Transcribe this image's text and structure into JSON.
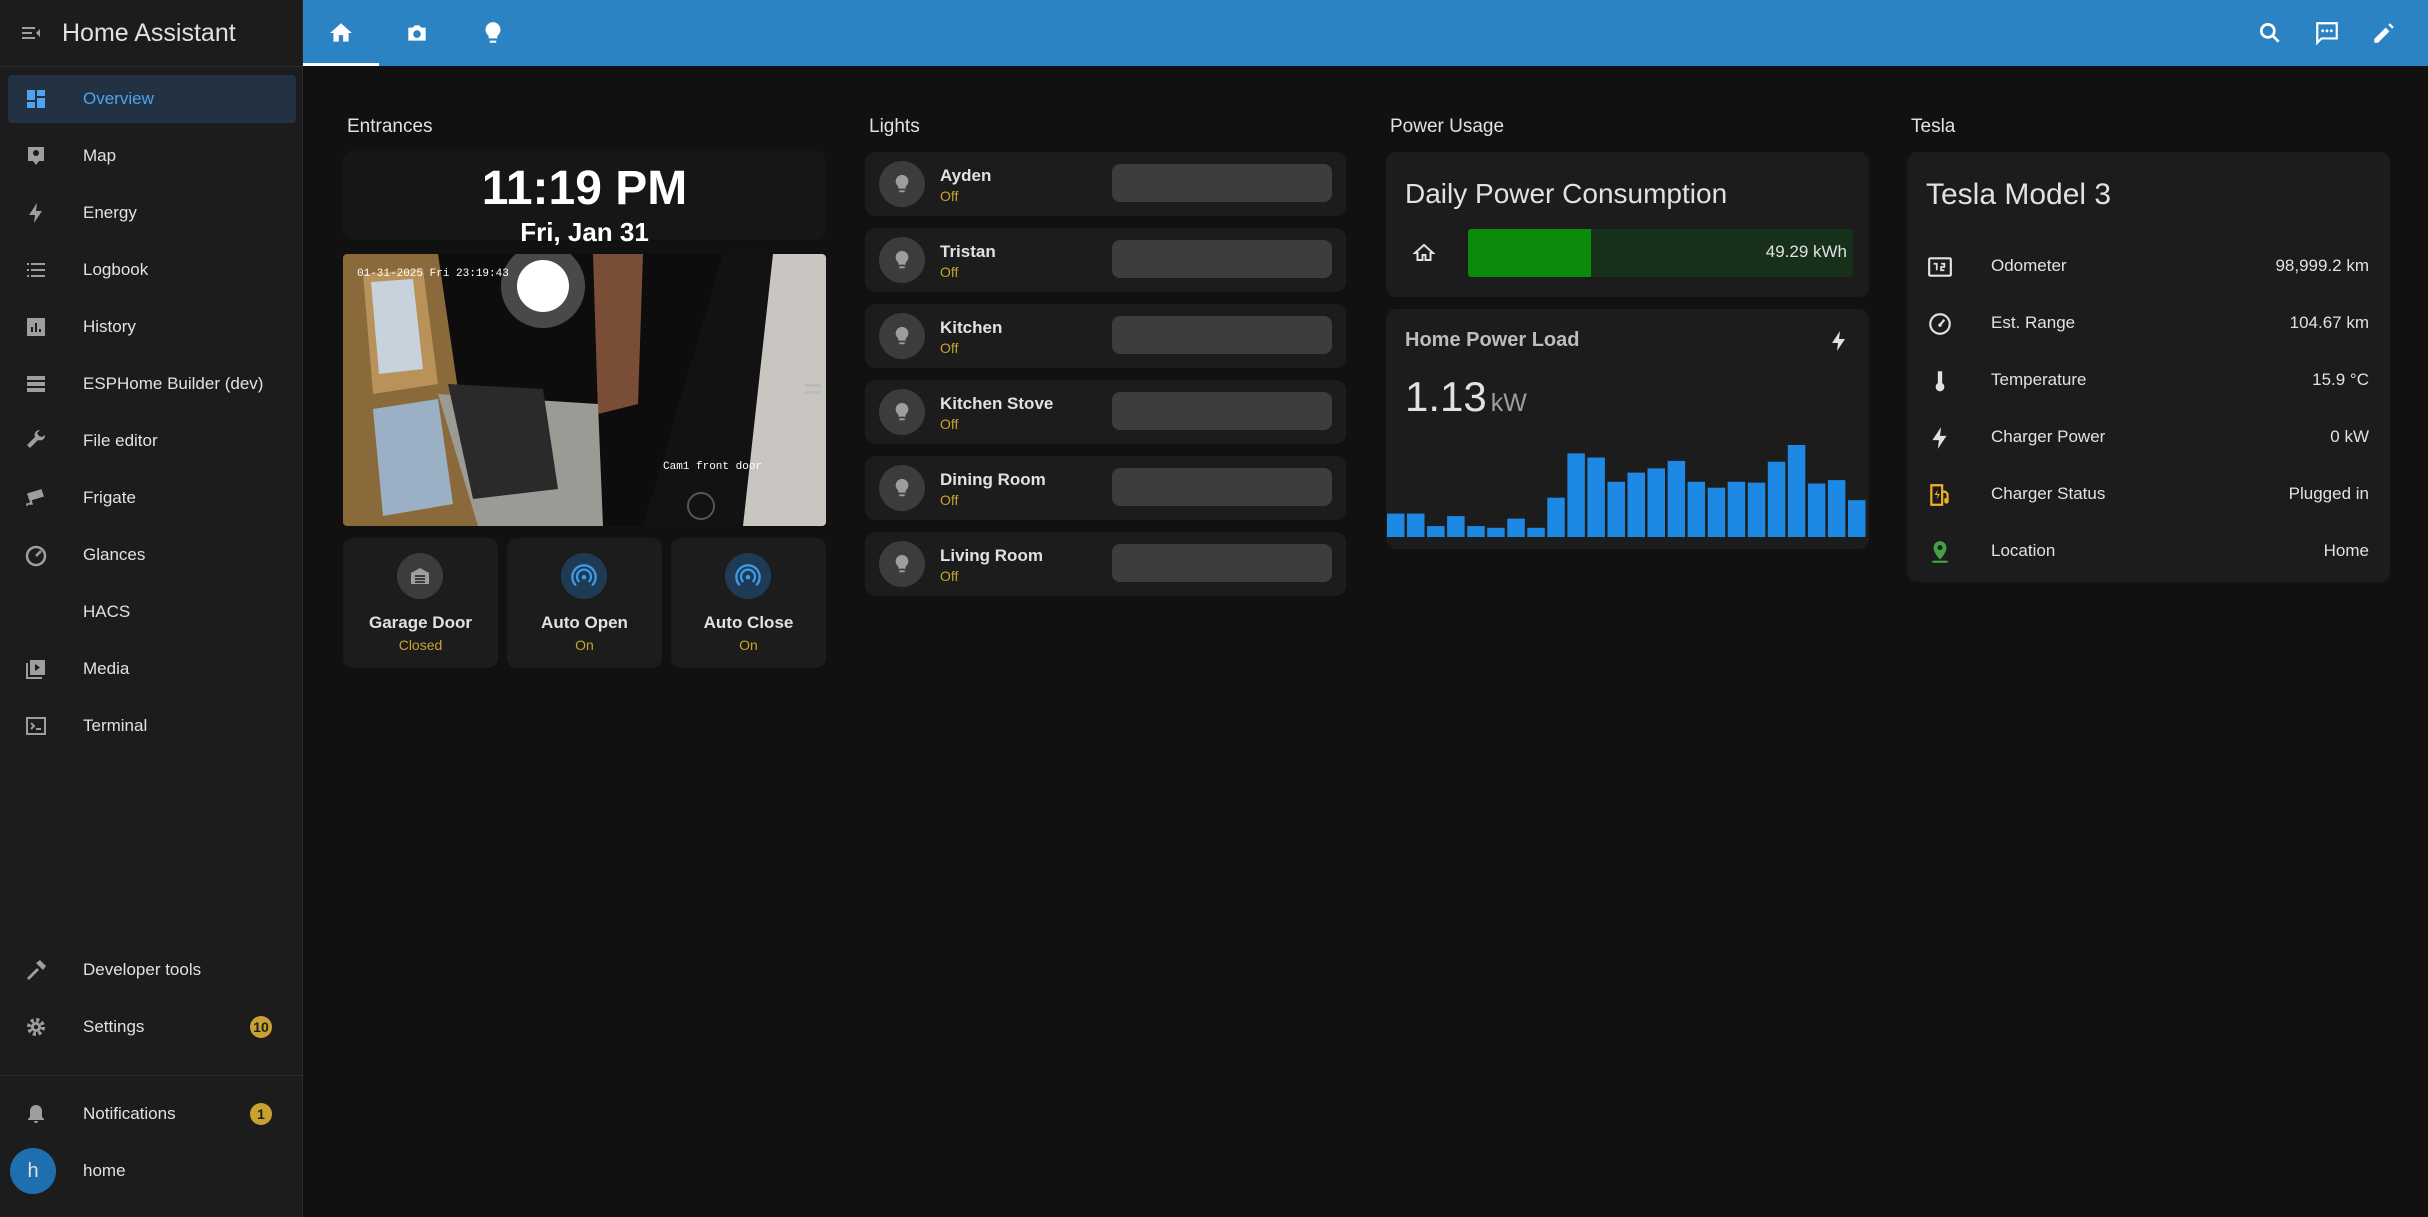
{
  "app": {
    "title": "Home Assistant"
  },
  "sidebar": {
    "items": [
      {
        "label": "Overview",
        "icon": "dashboard-icon",
        "active": true
      },
      {
        "label": "Map",
        "icon": "map-icon"
      },
      {
        "label": "Energy",
        "icon": "lightning-icon"
      },
      {
        "label": "Logbook",
        "icon": "list-icon"
      },
      {
        "label": "History",
        "icon": "bar-chart-icon"
      },
      {
        "label": "ESPHome Builder (dev)",
        "icon": "chip-icon"
      },
      {
        "label": "File editor",
        "icon": "wrench-icon"
      },
      {
        "label": "Frigate",
        "icon": "cctv-icon"
      },
      {
        "label": "Glances",
        "icon": "gauge-icon"
      },
      {
        "label": "HACS",
        "icon": ""
      },
      {
        "label": "Media",
        "icon": "media-icon"
      },
      {
        "label": "Terminal",
        "icon": "console-icon"
      }
    ],
    "developer_tools": "Developer tools",
    "settings": {
      "label": "Settings",
      "badge": "10"
    },
    "notifications": {
      "label": "Notifications",
      "badge": "1"
    },
    "user": {
      "initial": "h",
      "name": "home"
    }
  },
  "header": {
    "tabs": [
      "home-icon",
      "camera-icon",
      "lightbulb-icon"
    ],
    "actions": [
      "search-icon",
      "assist-icon",
      "pencil-icon"
    ],
    "color": "#2b83c3"
  },
  "entrances": {
    "title": "Entrances",
    "clock": {
      "time": "11:19 PM",
      "date": "Fri, Jan 31"
    },
    "camera": {
      "overlay_timestamp": "01-31-2025 Fri 23:19:43",
      "overlay_label": "Cam1 front door"
    },
    "tiles": [
      {
        "name": "Garage Door",
        "state": "Closed",
        "icon": "garage-icon"
      },
      {
        "name": "Auto Open",
        "state": "On",
        "icon": "wireless-icon"
      },
      {
        "name": "Auto Close",
        "state": "On",
        "icon": "wireless-icon"
      }
    ]
  },
  "lights": {
    "title": "Lights",
    "items": [
      {
        "name": "Ayden",
        "state": "Off"
      },
      {
        "name": "Tristan",
        "state": "Off"
      },
      {
        "name": "Kitchen",
        "state": "Off"
      },
      {
        "name": "Kitchen Stove",
        "state": "Off"
      },
      {
        "name": "Dining Room",
        "state": "Off"
      },
      {
        "name": "Living Room",
        "state": "Off"
      }
    ]
  },
  "power": {
    "title": "Power Usage",
    "daily": {
      "title": "Daily Power Consumption",
      "value": "49.29 kWh",
      "fill_fraction": 0.32
    },
    "load": {
      "title": "Home Power Load",
      "value": "1.13",
      "unit": "kW",
      "history": [
        0.28,
        0.28,
        0.13,
        0.25,
        0.13,
        0.11,
        0.22,
        0.11,
        0.47,
        1.0,
        0.95,
        0.66,
        0.77,
        0.82,
        0.91,
        0.66,
        0.59,
        0.66,
        0.65,
        0.9,
        1.1,
        0.64,
        0.68,
        0.44
      ],
      "bar_color": "#1e88e5"
    }
  },
  "tesla": {
    "title": "Tesla",
    "card_title": "Tesla Model 3",
    "rows": [
      {
        "label": "Odometer",
        "value": "98,999.2 km",
        "icon": "counter-icon"
      },
      {
        "label": "Est. Range",
        "value": "104.67 km",
        "icon": "speedometer-icon"
      },
      {
        "label": "Temperature",
        "value": "15.9 °C",
        "icon": "thermometer-icon"
      },
      {
        "label": "Charger Power",
        "value": "0 kW",
        "icon": "lightning-icon"
      },
      {
        "label": "Charger Status",
        "value": "Plugged in",
        "icon": "ev-station-icon"
      },
      {
        "label": "Location",
        "value": "Home",
        "icon": "map-marker-icon"
      }
    ]
  },
  "colors": {
    "accent": "#4ea3f1",
    "state_text": "#c8a231",
    "card": "#1c1c1c",
    "background": "#111111"
  }
}
